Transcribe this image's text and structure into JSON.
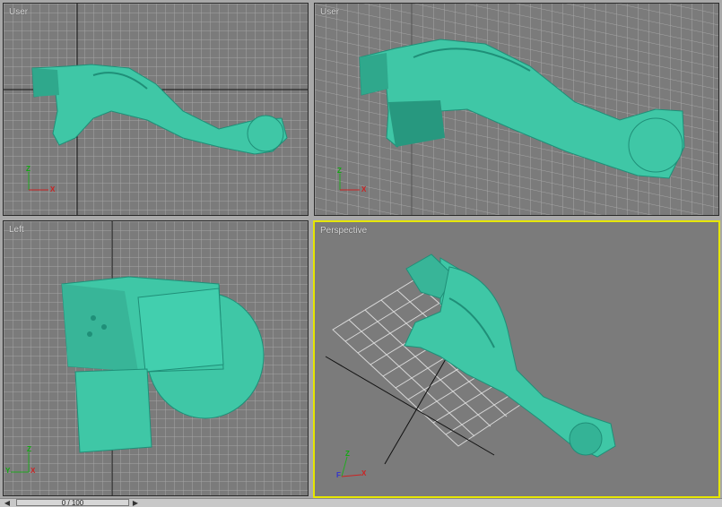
{
  "viewports": {
    "top_left": {
      "label": "User"
    },
    "top_right": {
      "label": "User"
    },
    "bottom_left": {
      "label": "Left"
    },
    "bottom_right": {
      "label": "Perspective"
    }
  },
  "axes": {
    "x": "X",
    "y": "Y",
    "z": "Z",
    "f": "F"
  },
  "timeline": {
    "frame_text": "0 / 100",
    "prev_icon": "arrow-left-icon",
    "next_icon": "arrow-right-icon"
  },
  "colors": {
    "viewport_bg": "#7b7b7b",
    "grid": "#a0a0a0",
    "model": "#3fc7a6",
    "model_shade": "#1f8f78",
    "active_border": "#e6e600"
  }
}
